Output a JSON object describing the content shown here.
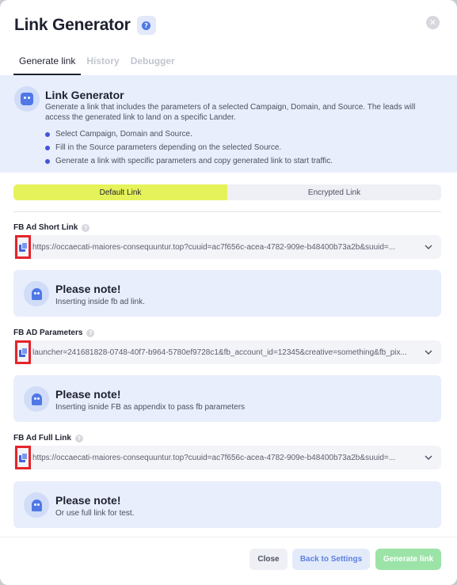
{
  "header": {
    "title": "Link Generator",
    "help_glyph": "?",
    "close_glyph": "✕"
  },
  "tabs": [
    {
      "label": "Generate link",
      "active": true
    },
    {
      "label": "History",
      "active": false
    },
    {
      "label": "Debugger",
      "active": false
    }
  ],
  "info": {
    "title": "Link Generator",
    "description": "Generate a link that includes the parameters of a selected Campaign, Domain, and Source. The leads will access the generated link to land on a specific Lander.",
    "bullets": [
      "Select Campaign, Domain and Source.",
      "Fill in the Source parameters depending on the selected Source.",
      "Generate a link with specific parameters and copy generated link to start traffic."
    ]
  },
  "toggle": {
    "default_label": "Default Link",
    "encrypted_label": "Encrypted Link",
    "selected": "Default Link"
  },
  "fields": [
    {
      "label": "FB Ad Short Link",
      "value": "https://occaecati-maiores-consequuntur.top?cuuid=ac7f656c-acea-4782-909e-b48400b73a2b&suuid=...",
      "note_title": "Please note!",
      "note_text": "Inserting inside fb ad link."
    },
    {
      "label": "FB AD Parameters",
      "value": "launcher=241681828-0748-40f7-b964-5780ef9728c1&fb_account_id=12345&creative=something&fb_pix...",
      "note_title": "Please note!",
      "note_text": "Inserting isnide FB as appendix to pass fb parameters"
    },
    {
      "label": "FB Ad Full Link",
      "value": "https://occaecati-maiores-consequuntur.top?cuuid=ac7f656c-acea-4782-909e-b48400b73a2b&suuid=...",
      "note_title": "Please note!",
      "note_text": "Or use full link for test."
    }
  ],
  "footer": {
    "close_label": "Close",
    "back_label": "Back to Settings",
    "generate_label": "Generate link"
  },
  "colors": {
    "accent": "#4f78e6",
    "highlight": "#e6f25a",
    "generate": "#9ce3a8",
    "copy_outline": "#e5242a"
  }
}
